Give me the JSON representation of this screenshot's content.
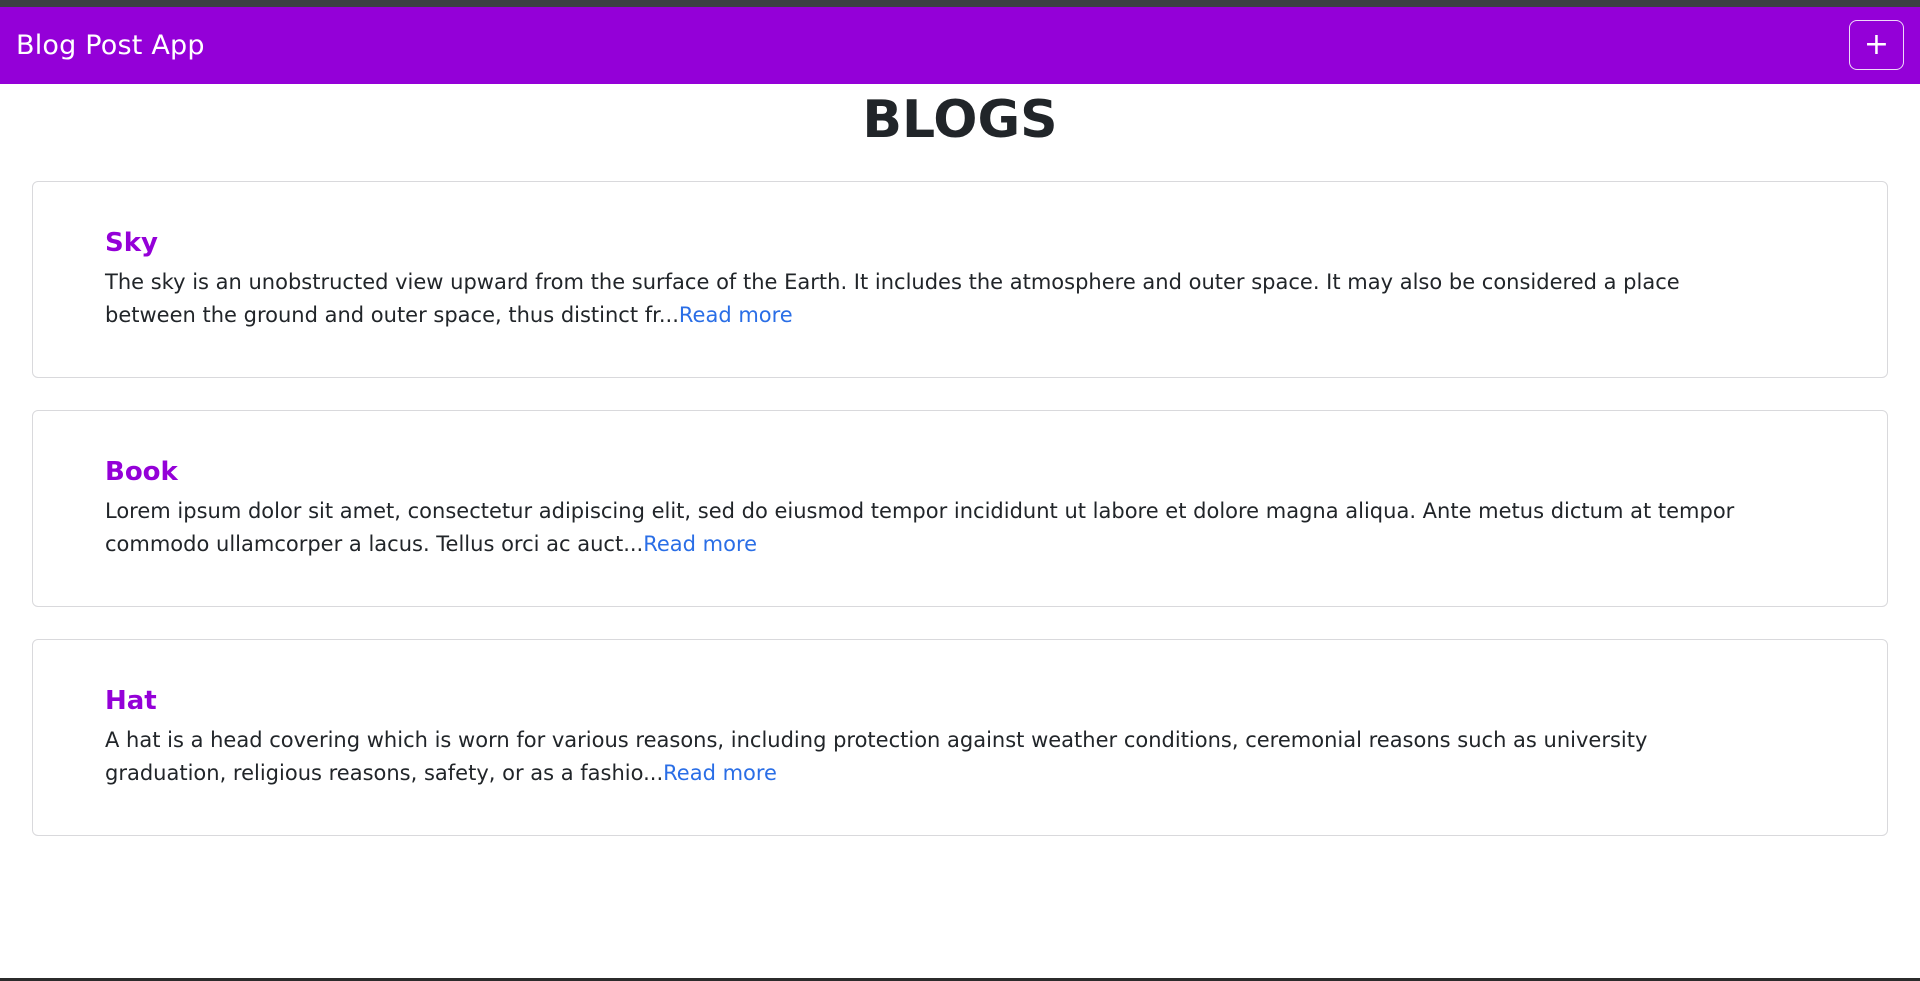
{
  "navbar": {
    "brand": "Blog Post App",
    "add_label": "+",
    "background_color": "#9400d8"
  },
  "page": {
    "title": "BLOGS"
  },
  "blogs": [
    {
      "title": "Sky",
      "excerpt": "The sky is an unobstructed view upward from the surface of the Earth. It includes the atmosphere and outer space. It may also be considered a place between the ground and outer space, thus distinct fr...",
      "read_more": "Read more"
    },
    {
      "title": "Book",
      "excerpt": "Lorem ipsum dolor sit amet, consectetur adipiscing elit, sed do eiusmod tempor incididunt ut labore et dolore magna aliqua. Ante metus dictum at tempor commodo ullamcorper a lacus. Tellus orci ac auct...",
      "read_more": "Read more"
    },
    {
      "title": "Hat",
      "excerpt": "A hat is a head covering which is worn for various reasons, including protection against weather conditions, ceremonial reasons such as university graduation, religious reasons, safety, or as a fashio...",
      "read_more": "Read more"
    }
  ],
  "colors": {
    "accent": "#9400d8",
    "link": "#2a6ee6",
    "text": "#212529"
  }
}
